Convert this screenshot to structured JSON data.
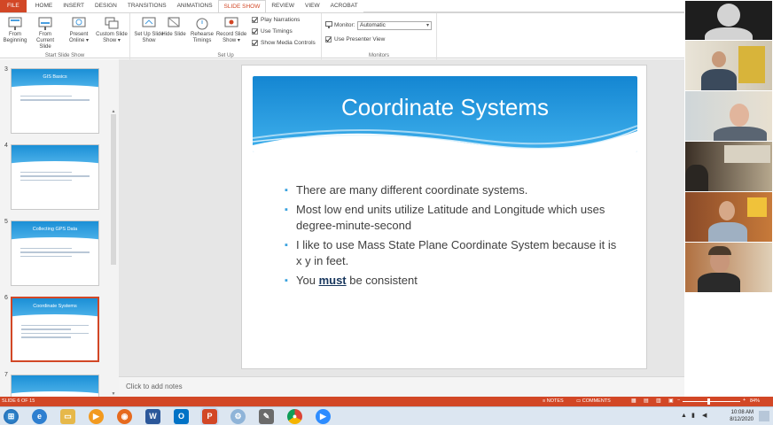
{
  "ribbon": {
    "tabs": [
      "FILE",
      "HOME",
      "INSERT",
      "DESIGN",
      "TRANSITIONS",
      "ANIMATIONS",
      "SLIDE SHOW",
      "REVIEW",
      "VIEW",
      "ACROBAT"
    ],
    "active_tab": "SLIDE SHOW",
    "groups": {
      "start": {
        "label": "Start Slide Show",
        "buttons": [
          "From Beginning",
          "From Current Slide",
          "Present Online ▾",
          "Custom Slide Show ▾"
        ]
      },
      "setup": {
        "label": "Set Up",
        "buttons": [
          "Set Up Slide Show",
          "Hide Slide",
          "Rehearse Timings",
          "Record Slide Show ▾"
        ],
        "checkboxes": [
          "Play Narrations",
          "Use Timings",
          "Show Media Controls"
        ]
      },
      "monitors": {
        "label": "Monitors",
        "monitor_label": "Monitor:",
        "monitor_value": "Automatic",
        "presenter_view": "Use Presenter View"
      }
    }
  },
  "thumbnails": [
    {
      "number": "3",
      "title": "GIS Basics",
      "selected": false
    },
    {
      "number": "4",
      "title": "",
      "selected": false
    },
    {
      "number": "5",
      "title": "Collecting GPS Data",
      "selected": false
    },
    {
      "number": "6",
      "title": "Coordinate Systems",
      "selected": true
    },
    {
      "number": "7",
      "title": "",
      "selected": false
    }
  ],
  "slide": {
    "title": "Coordinate Systems",
    "bullets": [
      {
        "text": "There are many different coordinate systems."
      },
      {
        "text": "Most low end units utilize Latitude and Longitude which uses degree-minute-second"
      },
      {
        "text": "I like to use Mass State Plane Coordinate System because it is x y in feet."
      },
      {
        "before": "You ",
        "emphasis": "must",
        "after": " be consistent"
      }
    ],
    "bullet_glyph": "▪",
    "accent_color": "#1b8fd6"
  },
  "notes_placeholder": "Click to add notes",
  "status": {
    "slide_indicator": "SLIDE 6 OF 15",
    "notes_label": "NOTES",
    "comments_label": "COMMENTS",
    "zoom": "84%"
  },
  "taskbar": {
    "time": "10:08 AM",
    "date": "8/12/2020"
  },
  "colors": {
    "brand": "#d24726",
    "slide_blue": "#1b8fd6",
    "taskbar": "#dce6f1"
  }
}
